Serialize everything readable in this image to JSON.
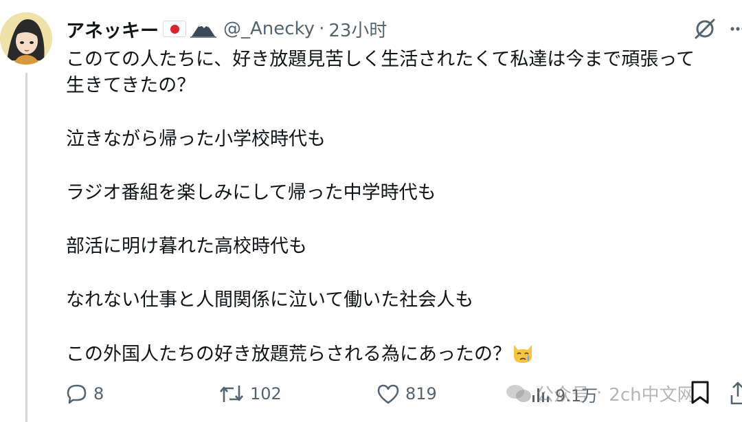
{
  "tweet": {
    "author_name": "アネッキー",
    "handle": "@_Anecky",
    "separator": "·",
    "time": "23小时",
    "lines": [
      "このての人たちに、好き放題見苦しく生活されたくて私達は今まで頑張って",
      "生きてきたの？",
      "泣きながら帰った小学校時代も",
      "ラジオ番組を楽しみにして帰った中学時代も",
      "部活に明け暮れた高校時代も",
      "なれない仕事と人間関係に泣いて働いた社会人も",
      "この外国人たちの好き放題荒らされる為にあったの？"
    ]
  },
  "icons": {
    "flag": "japan-flag-icon",
    "mountain": "mount-fuji-icon",
    "grok": "grok-icon",
    "more": "more-icon",
    "emoji": "crying-cat-face-emoji",
    "reply": "reply-icon",
    "retweet": "retweet-icon",
    "like": "like-icon",
    "views": "views-icon",
    "bookmark": "bookmark-icon",
    "share": "share-icon"
  },
  "actions": {
    "replies": "8",
    "retweets": "102",
    "likes": "819",
    "views": "9.1万"
  },
  "watermark": {
    "text_left": "公众号",
    "separator": "·",
    "text_right": "2ch中文网"
  },
  "colors": {
    "text": "#0f1419",
    "secondary": "#536471",
    "thread_line": "#cfd9de",
    "flag_red": "#d9242f"
  }
}
